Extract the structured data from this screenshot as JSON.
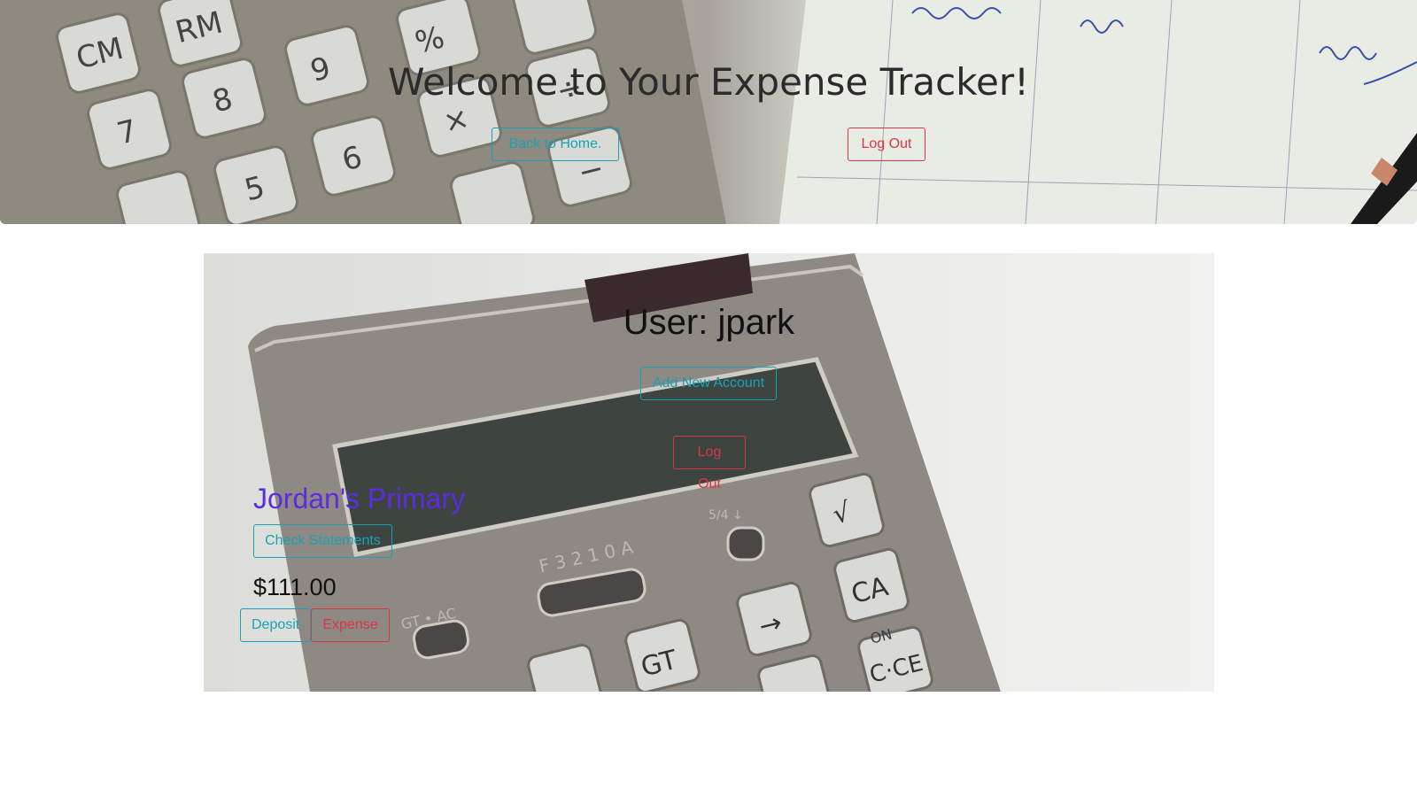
{
  "header": {
    "title": "Welcome to Your Expense Tracker!",
    "back_home_label": "Back to Home.",
    "logout_label": "Log Out"
  },
  "main": {
    "user_label": "User: jpark",
    "add_account_label": "Add New Account",
    "logout_label": "Log Out",
    "account": {
      "name": "Jordan's Primary",
      "check_statements_label": "Check Statements",
      "balance": "$111.00",
      "deposit_label": "Deposit",
      "expense_label": "Expense"
    }
  },
  "colors": {
    "info": "#17a2b8",
    "danger": "#dc3545",
    "account_name": "#5a2ee0"
  }
}
